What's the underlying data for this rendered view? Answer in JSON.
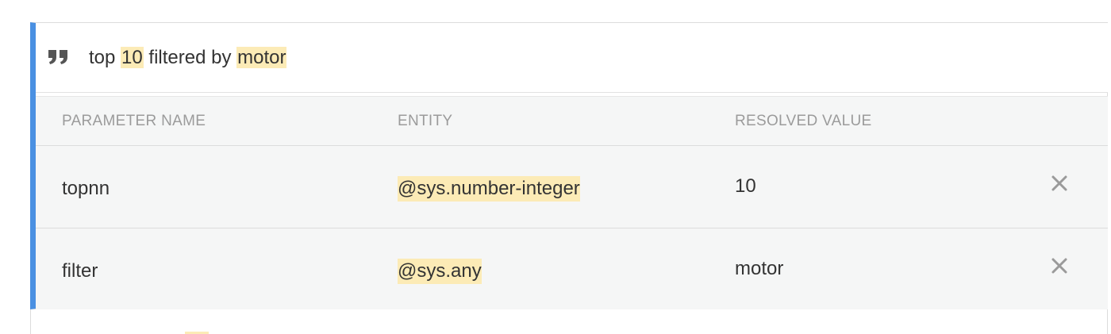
{
  "phrase": {
    "icon": "quote-icon",
    "parts": [
      "top ",
      "10",
      " filtered by ",
      "motor"
    ]
  },
  "params": {
    "headers": {
      "name": "PARAMETER NAME",
      "entity": "ENTITY",
      "value": "RESOLVED VALUE"
    },
    "rows": [
      {
        "name": "topnn",
        "entity": "@sys.number-integer",
        "value": "10",
        "delete_icon": "close-icon"
      },
      {
        "name": "filter",
        "entity": "@sys.any",
        "value": "motor",
        "delete_icon": "close-icon"
      }
    ]
  },
  "colors": {
    "accent": "#4a90e2",
    "highlight": "#fcebb6",
    "header_text": "#9b9b9b",
    "panel_bg": "#f5f6f6"
  }
}
